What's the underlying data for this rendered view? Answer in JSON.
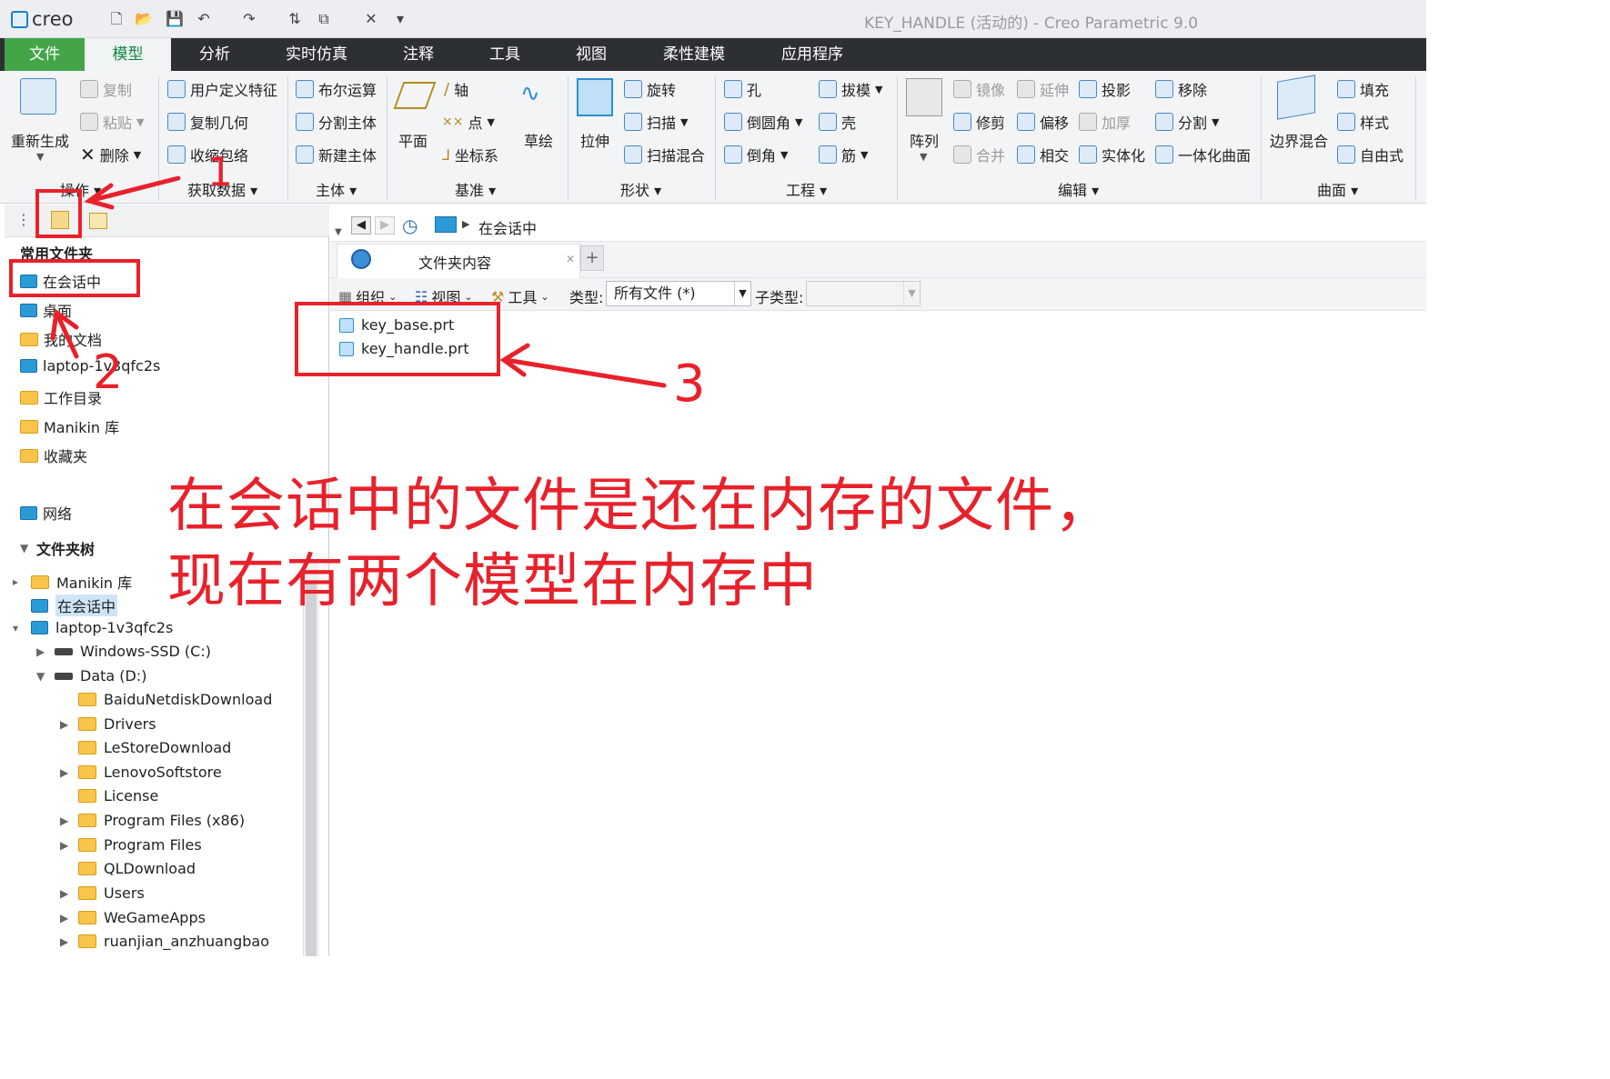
{
  "app": {
    "logo": "creo",
    "window_title": "KEY_HANDLE (活动的) - Creo Parametric 9.0"
  },
  "quick_access": [
    "new-icon",
    "open-icon",
    "save-icon",
    "undo-icon",
    "redo-icon",
    "regenerate-icon",
    "windows-icon",
    "close-icon",
    "customize-icon"
  ],
  "tabs": [
    "文件",
    "模型",
    "分析",
    "实时仿真",
    "注释",
    "工具",
    "视图",
    "柔性建模",
    "应用程序"
  ],
  "ribbon": {
    "operations": {
      "regen": "重新生成",
      "copy": "复制",
      "paste": "粘贴",
      "delete": "删除",
      "group": "操作"
    },
    "get_data": {
      "udf": "用户定义特征",
      "copy_geom": "复制几何",
      "shrinkwrap": "收缩包络",
      "group": "获取数据"
    },
    "body": {
      "boolean": "布尔运算",
      "split_body": "分割主体",
      "new_body": "新建主体",
      "group": "主体"
    },
    "datum": {
      "plane": "平面",
      "axis": "轴",
      "point": "点",
      "csys": "坐标系",
      "sketch": "草绘",
      "group": "基准"
    },
    "shapes": {
      "extrude": "拉伸",
      "revolve": "旋转",
      "sweep": "扫描",
      "swept_blend": "扫描混合",
      "group": "形状"
    },
    "engineering": {
      "hole": "孔",
      "round": "倒圆角",
      "chamfer": "倒角",
      "draft": "拔模",
      "shell": "壳",
      "rib": "筋",
      "group": "工程"
    },
    "editing": {
      "pattern": "阵列",
      "mirror": "镜像",
      "extend": "延伸",
      "project": "投影",
      "trim": "修剪",
      "offset": "偏移",
      "thicken": "加厚",
      "merge": "合并",
      "intersect": "相交",
      "solidify": "实体化",
      "remove": "移除",
      "split": "分割",
      "unify": "一体化曲面",
      "group": "编辑"
    },
    "surfaces": {
      "boundary_blend": "边界混合",
      "fill": "填充",
      "style": "样式",
      "freestyle": "自由式",
      "group": "曲面"
    }
  },
  "navigator": {
    "favorites_title": "常用文件夹",
    "favorites": [
      "在会话中",
      "桌面",
      "我的文档",
      "laptop-1v3qfc2s",
      "工作目录",
      "Manikin 库",
      "收藏夹"
    ],
    "network": "网络",
    "tree_title": "文件夹树",
    "tree": {
      "manikin": "Manikin 库",
      "session": "在会话中",
      "computer": "laptop-1v3qfc2s",
      "drive_c": "Windows-SSD (C:)",
      "drive_d": "Data (D:)",
      "folders": [
        "BaiduNetdiskDownload",
        "Drivers",
        "LeStoreDownload",
        "LenovoSoftstore",
        "License",
        "Program Files (x86)",
        "Program Files",
        "QLDownload",
        "Users",
        "WeGameApps",
        "ruanjian_anzhuangbao"
      ]
    }
  },
  "browser": {
    "address": "在会话中",
    "tab_label": "文件夹内容",
    "toolbar": {
      "organize": "组织",
      "view": "视图",
      "tools": "工具",
      "type_label": "类型:",
      "type_value": "所有文件 (*)",
      "subtype_label": "子类型:"
    },
    "files": [
      "key_base.prt",
      "key_handle.prt"
    ]
  },
  "annotations": {
    "numbers": [
      "1",
      "2",
      "3"
    ],
    "line1": "在会话中的文件是还在内存的文件，",
    "line2": "现在有两个模型在内存中"
  },
  "colors": {
    "accent_green": "#43a548",
    "annotation_red": "#e8212b",
    "tab_bar": "#2d3033"
  }
}
